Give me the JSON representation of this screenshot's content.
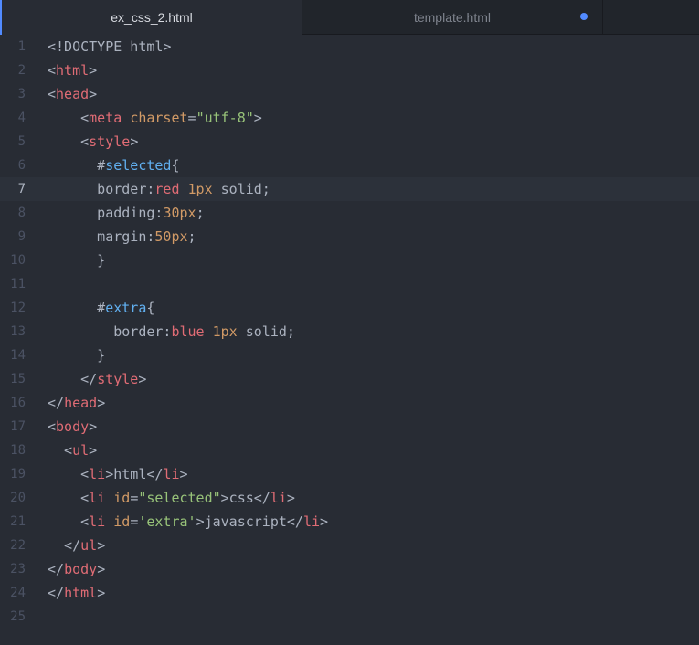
{
  "tabs": [
    {
      "label": "ex_css_2.html",
      "active": true,
      "modified": false
    },
    {
      "label": "template.html",
      "active": false,
      "modified": true
    }
  ],
  "colors": {
    "background": "#282c34",
    "tabbar": "#21252b",
    "accent": "#528bff",
    "tag": "#e06c75",
    "attribute": "#d19a66",
    "string": "#98c379",
    "selector_id": "#61afef",
    "text": "#abb2bf"
  },
  "editor": {
    "cursor_line": 7,
    "lines": [
      {
        "n": "1",
        "tokens": [
          [
            "plain",
            "<!DOCTYPE html>"
          ]
        ]
      },
      {
        "n": "2",
        "tokens": [
          [
            "plain",
            "<"
          ],
          [
            "tag",
            "html"
          ],
          [
            "plain",
            ">"
          ]
        ]
      },
      {
        "n": "3",
        "tokens": [
          [
            "plain",
            "<"
          ],
          [
            "tag",
            "head"
          ],
          [
            "plain",
            ">"
          ]
        ]
      },
      {
        "n": "4",
        "tokens": [
          [
            "plain",
            "    <"
          ],
          [
            "tag",
            "meta"
          ],
          [
            "plain",
            " "
          ],
          [
            "attr",
            "charset"
          ],
          [
            "plain",
            "="
          ],
          [
            "str",
            "\"utf-8\""
          ],
          [
            "plain",
            ">"
          ]
        ]
      },
      {
        "n": "5",
        "tokens": [
          [
            "plain",
            "    <"
          ],
          [
            "tag",
            "style"
          ],
          [
            "plain",
            ">"
          ]
        ]
      },
      {
        "n": "6",
        "tokens": [
          [
            "plain",
            "      #"
          ],
          [
            "id",
            "selected"
          ],
          [
            "plain",
            "{"
          ]
        ]
      },
      {
        "n": "7",
        "tokens": [
          [
            "plain",
            "      border:"
          ],
          [
            "kw",
            "red"
          ],
          [
            "plain",
            " "
          ],
          [
            "num",
            "1px"
          ],
          [
            "plain",
            " solid;"
          ]
        ]
      },
      {
        "n": "8",
        "tokens": [
          [
            "plain",
            "      padding:"
          ],
          [
            "num",
            "30px"
          ],
          [
            "plain",
            ";"
          ]
        ]
      },
      {
        "n": "9",
        "tokens": [
          [
            "plain",
            "      margin:"
          ],
          [
            "num",
            "50px"
          ],
          [
            "plain",
            ";"
          ]
        ]
      },
      {
        "n": "10",
        "tokens": [
          [
            "plain",
            "      }"
          ]
        ]
      },
      {
        "n": "11",
        "tokens": []
      },
      {
        "n": "12",
        "tokens": [
          [
            "plain",
            "      #"
          ],
          [
            "id",
            "extra"
          ],
          [
            "plain",
            "{"
          ]
        ]
      },
      {
        "n": "13",
        "tokens": [
          [
            "plain",
            "        border:"
          ],
          [
            "kw",
            "blue"
          ],
          [
            "plain",
            " "
          ],
          [
            "num",
            "1px"
          ],
          [
            "plain",
            " solid;"
          ]
        ]
      },
      {
        "n": "14",
        "tokens": [
          [
            "plain",
            "      }"
          ]
        ]
      },
      {
        "n": "15",
        "tokens": [
          [
            "plain",
            "    </"
          ],
          [
            "tag",
            "style"
          ],
          [
            "plain",
            ">"
          ]
        ]
      },
      {
        "n": "16",
        "tokens": [
          [
            "plain",
            "</"
          ],
          [
            "tag",
            "head"
          ],
          [
            "plain",
            ">"
          ]
        ]
      },
      {
        "n": "17",
        "tokens": [
          [
            "plain",
            "<"
          ],
          [
            "tag",
            "body"
          ],
          [
            "plain",
            ">"
          ]
        ]
      },
      {
        "n": "18",
        "tokens": [
          [
            "plain",
            "  <"
          ],
          [
            "tag",
            "ul"
          ],
          [
            "plain",
            ">"
          ]
        ]
      },
      {
        "n": "19",
        "tokens": [
          [
            "plain",
            "    <"
          ],
          [
            "tag",
            "li"
          ],
          [
            "plain",
            ">html</"
          ],
          [
            "tag",
            "li"
          ],
          [
            "plain",
            ">"
          ]
        ]
      },
      {
        "n": "20",
        "tokens": [
          [
            "plain",
            "    <"
          ],
          [
            "tag",
            "li"
          ],
          [
            "plain",
            " "
          ],
          [
            "attr",
            "id"
          ],
          [
            "plain",
            "="
          ],
          [
            "str",
            "\"selected\""
          ],
          [
            "plain",
            ">css</"
          ],
          [
            "tag",
            "li"
          ],
          [
            "plain",
            ">"
          ]
        ]
      },
      {
        "n": "21",
        "tokens": [
          [
            "plain",
            "    <"
          ],
          [
            "tag",
            "li"
          ],
          [
            "plain",
            " "
          ],
          [
            "attr",
            "id"
          ],
          [
            "plain",
            "="
          ],
          [
            "str",
            "'extra'"
          ],
          [
            "plain",
            ">javascript</"
          ],
          [
            "tag",
            "li"
          ],
          [
            "plain",
            ">"
          ]
        ]
      },
      {
        "n": "22",
        "tokens": [
          [
            "plain",
            "  </"
          ],
          [
            "tag",
            "ul"
          ],
          [
            "plain",
            ">"
          ]
        ]
      },
      {
        "n": "23",
        "tokens": [
          [
            "plain",
            "</"
          ],
          [
            "tag",
            "body"
          ],
          [
            "plain",
            ">"
          ]
        ]
      },
      {
        "n": "24",
        "tokens": [
          [
            "plain",
            "</"
          ],
          [
            "tag",
            "html"
          ],
          [
            "plain",
            ">"
          ]
        ]
      },
      {
        "n": "25",
        "tokens": []
      }
    ]
  }
}
